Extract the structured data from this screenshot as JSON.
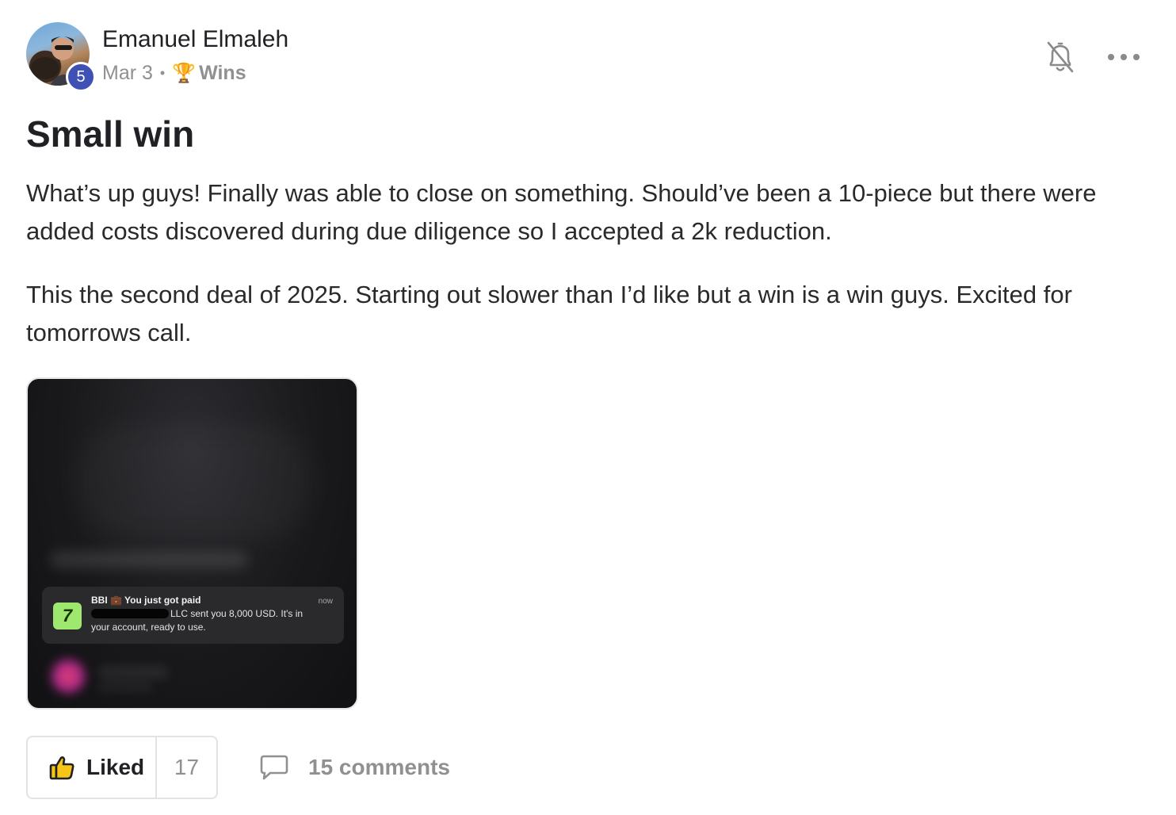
{
  "author": {
    "name": "Emanuel Elmaleh",
    "level": "5"
  },
  "meta": {
    "date": "Mar 3",
    "separator": "•",
    "category_icon": "🏆",
    "category": "Wins"
  },
  "icons": {
    "notification": "bell-off-icon",
    "more": "more-horizontal-icon",
    "like": "thumbs-up-icon",
    "comment": "comment-bubble-icon"
  },
  "post": {
    "title": "Small win",
    "paragraphs": [
      "What’s up guys! Finally was able to close on something. Should’ve been a 10-piece but there were added costs discovered during due diligence so I accepted a 2k reduction.",
      "This the second deal of 2025. Starting out slower than I’d like but a win is a win guys. Excited for tomorrows call."
    ]
  },
  "attachment": {
    "notification": {
      "app_icon_text": "7",
      "title": "BBI 💼 You just got paid",
      "time": "now",
      "line1": "LLC sent you 8,000 USD. It's in",
      "line2": "your account, ready to use."
    }
  },
  "actions": {
    "like_label": "Liked",
    "like_count": "17",
    "comments_label": "15 comments"
  },
  "colors": {
    "level_badge": "#3f51b5",
    "wise_green": "#9fe870",
    "muted_text": "#909090"
  }
}
